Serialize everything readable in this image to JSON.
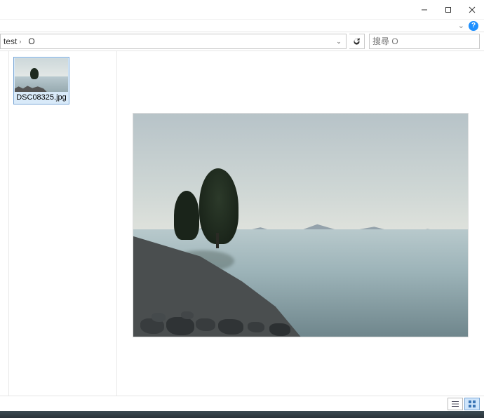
{
  "breadcrumb": {
    "segment1": "test",
    "sep": "›",
    "segment2": "O"
  },
  "address": {
    "dropdown_glyph": "⌄",
    "refresh_label": "Refresh"
  },
  "search": {
    "placeholder": "搜尋 O",
    "icon": "search-icon"
  },
  "helprow": {
    "chevron": "⌄",
    "badge": "?"
  },
  "files": [
    {
      "name": "DSC08325.jpg",
      "selected": true
    }
  ],
  "preview": {
    "source_file_index": 0
  },
  "window_controls": {
    "min": "Minimize",
    "max": "Maximize",
    "close": "Close"
  },
  "view_modes": {
    "details": "Details view",
    "thumbnails": "Large icons view",
    "active": "thumbnails"
  }
}
